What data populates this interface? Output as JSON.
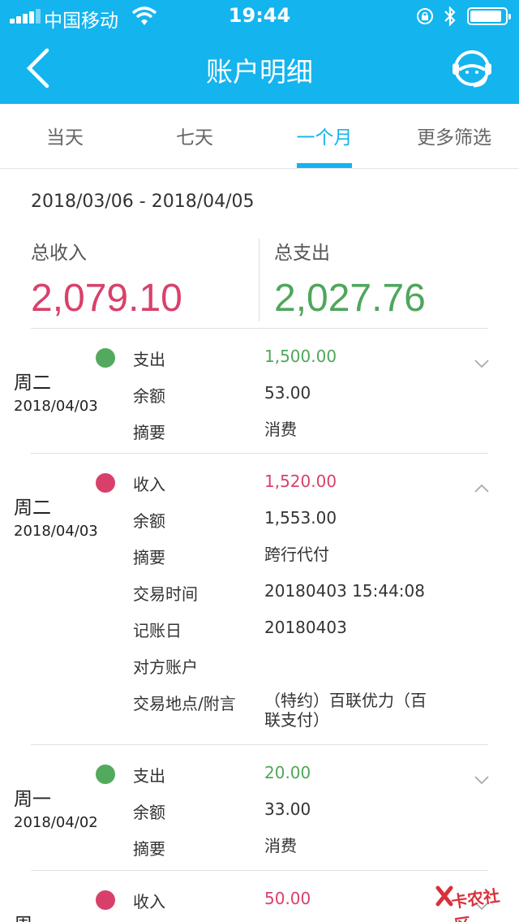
{
  "status_bar": {
    "carrier": "中国移动",
    "time": "19:44"
  },
  "header": {
    "title": "账户明细",
    "back_icon": "chevron-left-icon",
    "support_icon": "customer-service-icon"
  },
  "tabs": [
    {
      "label": "当天",
      "active": false
    },
    {
      "label": "七天",
      "active": false
    },
    {
      "label": "一个月",
      "active": true
    },
    {
      "label": "更多筛选",
      "active": false
    }
  ],
  "summary": {
    "date_range": "2018/03/06 - 2018/04/05",
    "income_label": "总收入",
    "income_value": "2,079.10",
    "expense_label": "总支出",
    "expense_value": "2,027.76"
  },
  "transactions": [
    {
      "weekday": "周二",
      "date": "2018/04/03",
      "type": "expense",
      "expanded": false,
      "rows": [
        {
          "label": "支出",
          "value": "1,500.00"
        },
        {
          "label": "余额",
          "value": "53.00"
        },
        {
          "label": "摘要",
          "value": "消费"
        }
      ]
    },
    {
      "weekday": "周二",
      "date": "2018/04/03",
      "type": "income",
      "expanded": true,
      "rows": [
        {
          "label": "收入",
          "value": "1,520.00"
        },
        {
          "label": "余额",
          "value": "1,553.00"
        },
        {
          "label": "摘要",
          "value": "跨行代付"
        },
        {
          "label": "交易时间",
          "value": "20180403 15:44:08"
        },
        {
          "label": "记账日",
          "value": "20180403"
        },
        {
          "label": "对方账户",
          "value": ""
        },
        {
          "label": "交易地点/附言",
          "value": "（特约）百联优力（百联支付）"
        }
      ]
    },
    {
      "weekday": "周一",
      "date": "2018/04/02",
      "type": "expense",
      "expanded": false,
      "rows": [
        {
          "label": "支出",
          "value": "20.00"
        },
        {
          "label": "余额",
          "value": "33.00"
        },
        {
          "label": "摘要",
          "value": "消费"
        }
      ]
    },
    {
      "weekday": "周一",
      "date": "",
      "type": "income",
      "expanded": false,
      "rows": [
        {
          "label": "收入",
          "value": "50.00"
        }
      ]
    }
  ],
  "watermark": {
    "text": "卡农社区"
  },
  "colors": {
    "primary": "#14b4ee",
    "income": "#d9416a",
    "expense": "#4fa65c"
  }
}
